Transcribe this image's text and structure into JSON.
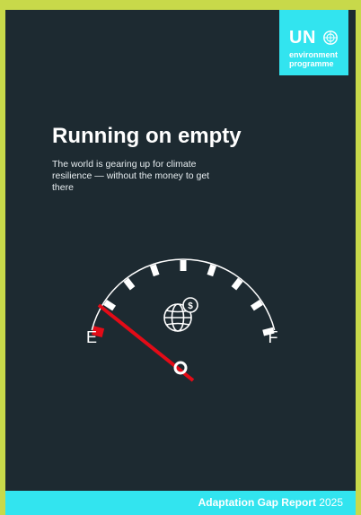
{
  "logo": {
    "mark": "UN",
    "line1": "environment",
    "line2": "programme",
    "emblem_icon": "un-emblem-icon"
  },
  "title": "Running on empty",
  "subtitle": "The world is gearing up for climate resilience — without the money to get there",
  "gauge": {
    "empty_label": "E",
    "full_label": "F",
    "center_icon": "globe-dollar-icon",
    "needle_level": 0.0
  },
  "footer": {
    "report_name": "Adaptation Gap Report",
    "year": "2025"
  },
  "colors": {
    "background": "#1d2a31",
    "accent_cyan": "#32e4ef",
    "border_yellow": "#c8d94a",
    "needle_red": "#e30b17"
  }
}
